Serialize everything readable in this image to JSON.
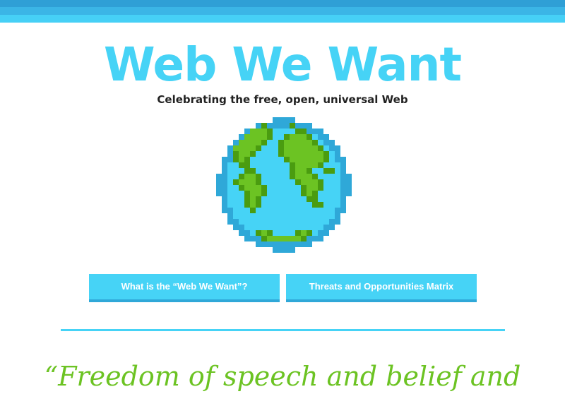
{
  "header": {
    "title": "Web We Want",
    "tagline": "Celebrating the free, open, universal Web"
  },
  "globe": {
    "icon": "pixel-globe-icon",
    "ocean_color": "#46d3f6",
    "land_color": "#6cc323"
  },
  "nav": {
    "buttons": [
      {
        "label": "What is the “Web We Want”?"
      },
      {
        "label": "Threats and Opportunities Matrix"
      }
    ]
  },
  "quote": {
    "text": "“Freedom of speech and belief and"
  },
  "colors": {
    "accent": "#46d3f6",
    "accent_dark": "#2f9fd6",
    "quote_green": "#6cc323",
    "text_dark": "#222222"
  }
}
